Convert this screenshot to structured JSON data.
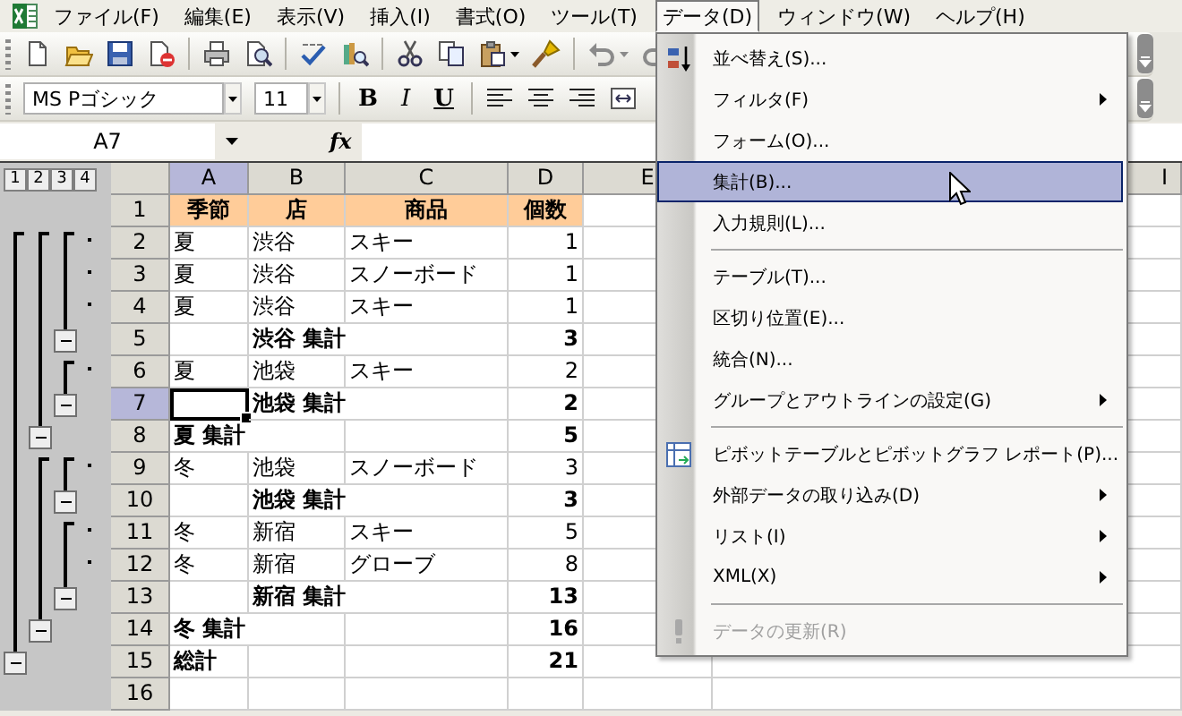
{
  "menu_bar": {
    "items": [
      {
        "label": "ファイル(F)",
        "selected": false
      },
      {
        "label": "編集(E)",
        "selected": false
      },
      {
        "label": "表示(V)",
        "selected": false
      },
      {
        "label": "挿入(I)",
        "selected": false
      },
      {
        "label": "書式(O)",
        "selected": false
      },
      {
        "label": "ツール(T)",
        "selected": false
      },
      {
        "label": "データ(D)",
        "selected": true
      },
      {
        "label": "ウィンドウ(W)",
        "selected": false
      },
      {
        "label": "ヘルプ(H)",
        "selected": false
      }
    ]
  },
  "formatting_toolbar": {
    "font": "MS Pゴシック",
    "size": "11",
    "style_buttons": [
      "B",
      "I",
      "U"
    ]
  },
  "formula_bar": {
    "name_box": "A7",
    "function_label": "fx"
  },
  "outline_levels": [
    "1",
    "2",
    "3",
    "4"
  ],
  "columns": [
    {
      "label": "A",
      "selected": true
    },
    {
      "label": "B",
      "selected": false
    },
    {
      "label": "C",
      "selected": false
    },
    {
      "label": "D",
      "selected": false
    },
    {
      "label": "E",
      "selected": false
    },
    {
      "label": "I",
      "selected": false
    }
  ],
  "rows": [
    {
      "number": "1",
      "kind": "header",
      "selected": false,
      "cells": [
        "季節",
        "店",
        "商品",
        "個数"
      ]
    },
    {
      "number": "2",
      "kind": "detail",
      "selected": false,
      "cells": [
        "夏",
        "渋谷",
        "スキー",
        "1"
      ]
    },
    {
      "number": "3",
      "kind": "detail",
      "selected": false,
      "cells": [
        "夏",
        "渋谷",
        "スノーボード",
        "1"
      ]
    },
    {
      "number": "4",
      "kind": "detail",
      "selected": false,
      "cells": [
        "夏",
        "渋谷",
        "スキー",
        "1"
      ]
    },
    {
      "number": "5",
      "kind": "subtotal",
      "selected": false,
      "cells": [
        null,
        "渋谷 集計",
        null,
        "3"
      ]
    },
    {
      "number": "6",
      "kind": "detail",
      "selected": false,
      "cells": [
        "夏",
        "池袋",
        "スキー",
        "2"
      ]
    },
    {
      "number": "7",
      "kind": "subtotal",
      "selected": true,
      "cells": [
        null,
        "池袋 集計",
        null,
        "2"
      ]
    },
    {
      "number": "8",
      "kind": "season_total",
      "selected": false,
      "cells": [
        "夏 集計",
        null,
        null,
        "5"
      ]
    },
    {
      "number": "9",
      "kind": "detail",
      "selected": false,
      "cells": [
        "冬",
        "池袋",
        "スノーボード",
        "3"
      ]
    },
    {
      "number": "10",
      "kind": "subtotal",
      "selected": false,
      "cells": [
        null,
        "池袋 集計",
        null,
        "3"
      ]
    },
    {
      "number": "11",
      "kind": "detail",
      "selected": false,
      "cells": [
        "冬",
        "新宿",
        "スキー",
        "5"
      ]
    },
    {
      "number": "12",
      "kind": "detail",
      "selected": false,
      "cells": [
        "冬",
        "新宿",
        "グローブ",
        "8"
      ]
    },
    {
      "number": "13",
      "kind": "subtotal",
      "selected": false,
      "cells": [
        null,
        "新宿 集計",
        null,
        "13"
      ]
    },
    {
      "number": "14",
      "kind": "season_total",
      "selected": false,
      "cells": [
        "冬 集計",
        null,
        null,
        "16"
      ]
    },
    {
      "number": "15",
      "kind": "grand_total",
      "selected": false,
      "cells": [
        "総計",
        null,
        null,
        "21"
      ]
    },
    {
      "number": "16",
      "kind": "blank",
      "selected": false,
      "cells": []
    }
  ],
  "data_menu": {
    "items": [
      {
        "kind": "sort_item",
        "label": "並べ替え(S)...",
        "selected": false,
        "disabled": false,
        "submenu": false
      },
      {
        "kind": "item",
        "label": "フィルタ(F)",
        "selected": false,
        "disabled": false,
        "submenu": true
      },
      {
        "kind": "item",
        "label": "フォーム(O)...",
        "selected": false,
        "disabled": false,
        "submenu": false
      },
      {
        "kind": "item",
        "label": "集計(B)...",
        "selected": true,
        "disabled": false,
        "submenu": false
      },
      {
        "kind": "item",
        "label": "入力規則(L)...",
        "selected": false,
        "disabled": false,
        "submenu": false
      },
      {
        "kind": "separator"
      },
      {
        "kind": "item",
        "label": "テーブル(T)...",
        "selected": false,
        "disabled": false,
        "submenu": false
      },
      {
        "kind": "item",
        "label": "区切り位置(E)...",
        "selected": false,
        "disabled": false,
        "submenu": false
      },
      {
        "kind": "item",
        "label": "統合(N)...",
        "selected": false,
        "disabled": false,
        "submenu": false
      },
      {
        "kind": "item",
        "label": "グループとアウトラインの設定(G)",
        "selected": false,
        "disabled": false,
        "submenu": true
      },
      {
        "kind": "separator"
      },
      {
        "kind": "pivot_item",
        "label": "ピボットテーブルとピボットグラフ レポート(P)...",
        "selected": false,
        "disabled": false,
        "submenu": false
      },
      {
        "kind": "item",
        "label": "外部データの取り込み(D)",
        "selected": false,
        "disabled": false,
        "submenu": true
      },
      {
        "kind": "item",
        "label": "リスト(I)",
        "selected": false,
        "disabled": false,
        "submenu": true
      },
      {
        "kind": "item",
        "label": "XML(X)",
        "selected": false,
        "disabled": false,
        "submenu": true
      },
      {
        "kind": "separator"
      },
      {
        "kind": "refresh_item",
        "label": "データの更新(R)",
        "selected": false,
        "disabled": true,
        "submenu": false
      }
    ]
  }
}
